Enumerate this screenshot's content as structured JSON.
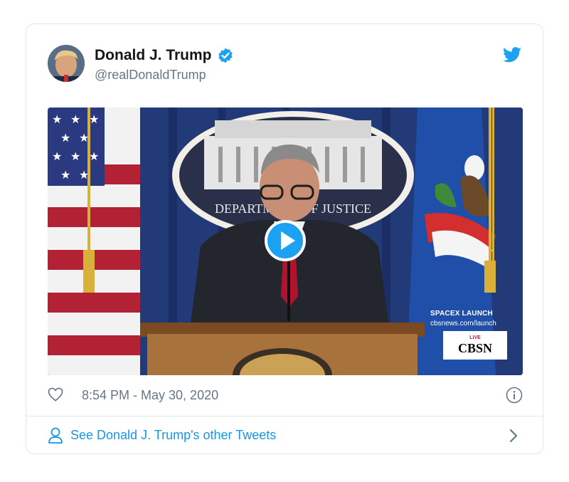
{
  "author": {
    "display_name": "Donald J. Trump",
    "handle": "@realDonaldTrump"
  },
  "media": {
    "watermark_line1": "SPACEX LAUNCH",
    "watermark_line2": "cbsnews.com/launch",
    "logo_live": "LIVE",
    "logo_brand": "CBSN",
    "seal_text": "DEPARTMENT OF JUSTICE"
  },
  "tweet": {
    "timestamp": "8:54 PM - May 30, 2020"
  },
  "footer": {
    "other_tweets_label": "See Donald J. Trump's other Tweets"
  },
  "colors": {
    "accent": "#1da1f2",
    "link": "#1b95e0",
    "muted": "#657786",
    "border": "#e1e8ed"
  },
  "icons": [
    "verified-icon",
    "twitter-bird-icon",
    "play-icon",
    "heart-icon",
    "info-icon",
    "person-icon",
    "chevron-right-icon"
  ]
}
